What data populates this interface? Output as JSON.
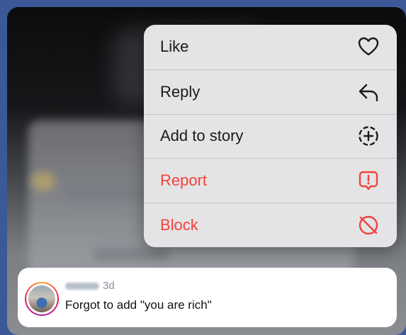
{
  "menu": {
    "items": [
      {
        "label": "Like",
        "icon": "heart-icon",
        "style": "normal"
      },
      {
        "label": "Reply",
        "icon": "reply-arrow-icon",
        "style": "normal"
      },
      {
        "label": "Add to story",
        "icon": "add-circle-dashed-icon",
        "style": "normal"
      },
      {
        "label": "Report",
        "icon": "report-exclamation-icon",
        "style": "danger"
      },
      {
        "label": "Block",
        "icon": "block-icon",
        "style": "danger"
      }
    ]
  },
  "comment": {
    "time": "3d",
    "text": "Forgot to add \"you are rich\""
  },
  "colors": {
    "danger": "#f2433b",
    "menu_background": "#e4e4e6",
    "page_background": "#3b5998"
  }
}
